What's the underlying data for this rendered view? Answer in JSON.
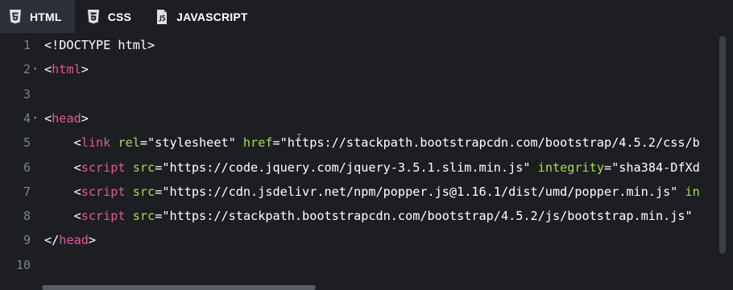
{
  "tabs": [
    {
      "label": "HTML",
      "icon": "html5-icon",
      "active": true
    },
    {
      "label": "CSS",
      "icon": "css3-icon",
      "active": false
    },
    {
      "label": "JAVASCRIPT",
      "icon": "js-file-icon",
      "active": false
    }
  ],
  "editor": {
    "line_numbers": [
      "1",
      "2",
      "3",
      "4",
      "5",
      "6",
      "7",
      "8",
      "9",
      "10"
    ],
    "colors": {
      "tag": "#e2589b",
      "attribute": "#a6dd5a",
      "text": "#ffffff",
      "gutter": "#7d8193",
      "background": "#1d1e22"
    },
    "lines": [
      {
        "parts": [
          "<!DOCTYPE html>"
        ]
      },
      {
        "parts": [
          "<",
          "html",
          ">"
        ]
      },
      {
        "parts": []
      },
      {
        "parts": [
          "<",
          "head",
          ">"
        ]
      },
      {
        "parts": [
          "    <",
          "link",
          " ",
          "rel",
          "=\"stylesheet\" ",
          "href",
          "=\"https://stackpath.bootstrapcdn.com/bootstrap/4.5.2/css/b"
        ]
      },
      {
        "parts": [
          "    <",
          "script",
          " ",
          "src",
          "=\"https://code.jquery.com/jquery-3.5.1.slim.min.js\" ",
          "integrity",
          "=\"sha384-DfXd"
        ]
      },
      {
        "parts": [
          "    <",
          "script",
          " ",
          "src",
          "=\"https://cdn.jsdelivr.net/npm/popper.js@1.16.1/dist/umd/popper.min.js\" ",
          "in"
        ]
      },
      {
        "parts": [
          "    <",
          "script",
          " ",
          "src",
          "=\"https://stackpath.bootstrapcdn.com/bootstrap/4.5.2/js/bootstrap.min.js\""
        ]
      },
      {
        "parts": [
          "</",
          "head",
          ">"
        ]
      },
      {
        "parts": []
      }
    ]
  }
}
